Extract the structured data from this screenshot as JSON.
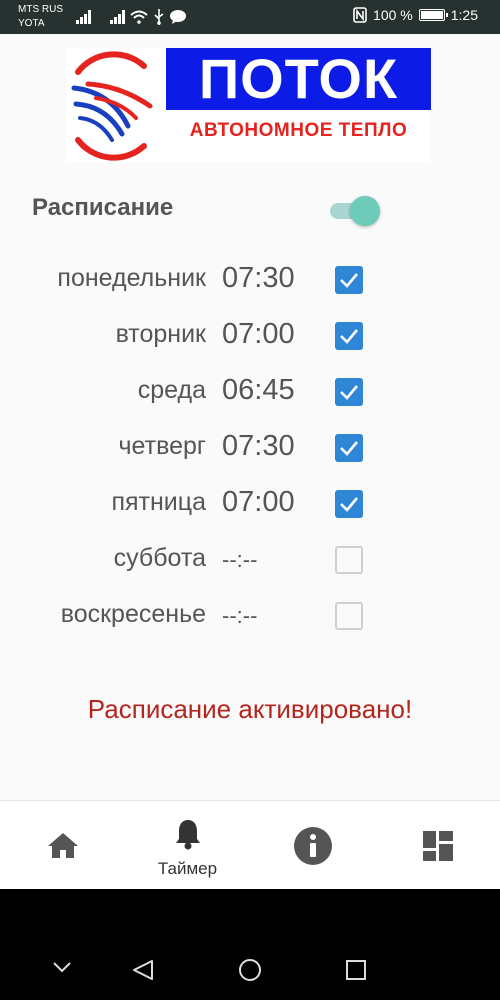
{
  "status_bar": {
    "carrier_1": "MTS RUS",
    "carrier_2": "YOTA",
    "battery": "100 %",
    "time": "1:25",
    "icons": [
      "signal-icon",
      "signal-icon",
      "wifi-icon",
      "usb-icon",
      "message-icon",
      "nfc-icon",
      "battery-icon"
    ]
  },
  "logo": {
    "title": "ПОТОК",
    "subtitle": "АВТОНОМНОЕ ТЕПЛО"
  },
  "schedule": {
    "label": "Расписание",
    "enabled": true,
    "days": [
      {
        "name": "понедельник",
        "time": "07:30",
        "checked": true
      },
      {
        "name": "вторник",
        "time": "07:00",
        "checked": true
      },
      {
        "name": "среда",
        "time": "06:45",
        "checked": true
      },
      {
        "name": "четверг",
        "time": "07:30",
        "checked": true
      },
      {
        "name": "пятница",
        "time": "07:00",
        "checked": true
      },
      {
        "name": "суббота",
        "time": "--:--",
        "checked": false
      },
      {
        "name": "воскресенье",
        "time": "--:--",
        "checked": false
      }
    ],
    "status_message": "Расписание активировано!"
  },
  "bottom_nav": {
    "items": [
      {
        "icon": "home-icon",
        "label": ""
      },
      {
        "icon": "bell-icon",
        "label": "Таймер"
      },
      {
        "icon": "info-icon",
        "label": ""
      },
      {
        "icon": "dashboard-icon",
        "label": ""
      }
    ],
    "active_index": 1
  },
  "system_nav": {
    "icons": [
      "chevron-down-icon",
      "back-icon",
      "home-circle-icon",
      "recents-icon"
    ]
  },
  "colors": {
    "accent": "#2f86d6",
    "toggle": "#6ccbb9",
    "status_message": "#b3261e",
    "logo_blue": "#0d1be6",
    "logo_red": "#e52420"
  }
}
